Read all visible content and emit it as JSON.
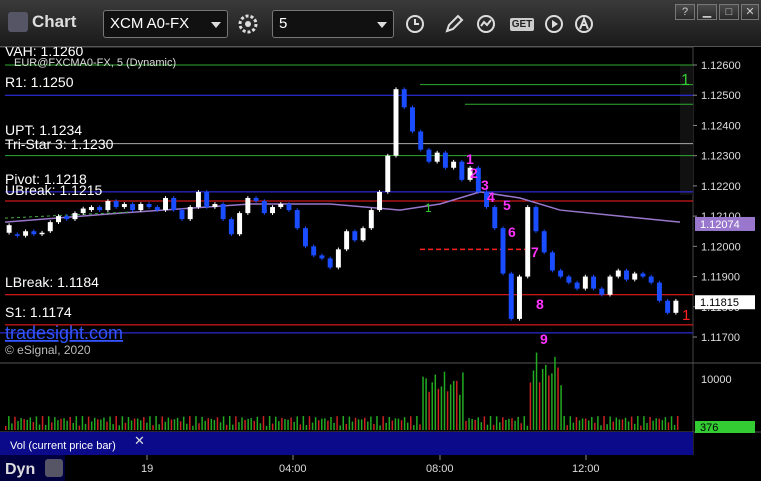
{
  "app": {
    "title": "Chart"
  },
  "toolbar": {
    "symbol": "XCM A0-FX",
    "interval": "5",
    "get_label": "GET"
  },
  "chart": {
    "symbol_line": "EUR@FXCMA0-FX, 5 (Dynamic)",
    "copyright": "© eSignal, 2020",
    "watermark": "tradesight.com",
    "volume_label": "Vol (current price bar)",
    "dyn_label": "Dyn",
    "level_labels": [
      {
        "text": "VAH: 1.1260",
        "price": 1.126,
        "color": "#ffffff"
      },
      {
        "text": "R1: 1.1250",
        "price": 1.125,
        "color": "#ffffff"
      },
      {
        "text": "UPT: 1.1234",
        "price": 1.1234,
        "color": "#ffffff"
      },
      {
        "text": "Tri-Star 3: 1.1230",
        "price": 1.123,
        "color": "#ffffff"
      },
      {
        "text": "Pivot: 1.1218",
        "price": 1.1218,
        "color": "#ffffff"
      },
      {
        "text": "UBreak: 1.1215",
        "price": 1.1215,
        "color": "#ffffff"
      },
      {
        "text": "LBreak: 1.1184",
        "price": 1.1184,
        "color": "#ffffff"
      },
      {
        "text": "S1: 1.1174",
        "price": 1.1174,
        "color": "#ffffff"
      }
    ],
    "price_ticks": [
      "1.12600",
      "1.12500",
      "1.12400",
      "1.12300",
      "1.12200",
      "1.12100",
      "1.12000",
      "1.11900",
      "1.11800",
      "1.11700"
    ],
    "price_tick_values": [
      1.126,
      1.125,
      1.124,
      1.123,
      1.122,
      1.121,
      1.12,
      1.119,
      1.118,
      1.117
    ],
    "current_price": "1.11815",
    "ma_price": "1.12074",
    "volume_ticks": [
      "10000"
    ],
    "current_volume": "376",
    "time_ticks": [
      "19",
      "04:00",
      "08:00",
      "12:00"
    ],
    "seq_marks": [
      "1",
      "2",
      "3",
      "4",
      "5",
      "6",
      "7",
      "8",
      "9"
    ],
    "green_marks": [
      "1",
      "1"
    ],
    "red_mark": "1"
  },
  "colors": {
    "up": "#ffffff",
    "down": "#1a4dff",
    "magenta": "#ff33ff",
    "green_line": "#2faa2f",
    "red_line": "#ff2020",
    "blue_line": "#3333ff",
    "ma": "#9977cc",
    "volume_bg": "#0a0a8a"
  },
  "icons": [
    "settings-icon",
    "clock-icon",
    "pencil-icon",
    "cursor-icon",
    "get-icon",
    "play-icon",
    "alert-icon"
  ]
}
